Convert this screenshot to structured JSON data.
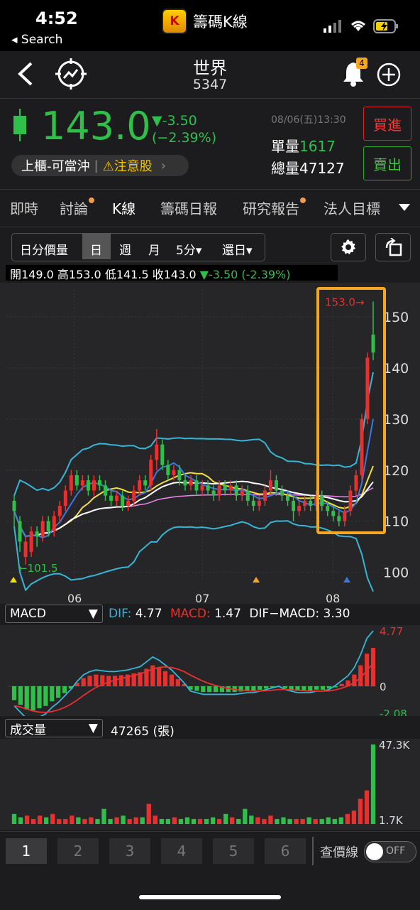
{
  "status": {
    "time": "4:52",
    "back_label": "◂ Search",
    "app_title": "籌碼K線",
    "logo_letter": "K",
    "battery_icon": "battery-charging-icon"
  },
  "header": {
    "name": "世界",
    "code": "5347",
    "notification_count": "4"
  },
  "quote": {
    "price": "143.0",
    "change": "▼-3.50",
    "change_pct": "(−2.39%)",
    "datetime": "08/06(五)13:30",
    "single_vol_label": "單量",
    "single_vol": "1617",
    "total_vol_label": "總量",
    "total_vol": "47127",
    "buy_label": "買進",
    "sell_label": "賣出",
    "badge_market": "上櫃-可當沖",
    "badge_warning": "⚠注意股"
  },
  "tabs": [
    "即時",
    "討論",
    "K線",
    "籌碼日報",
    "研究報告",
    "法人目標"
  ],
  "chart_toolbar": {
    "opt1": "日分價量",
    "opt2": "日",
    "opt3": "週",
    "opt4": "月",
    "opt5": "5分▾",
    "opt6": "還日▾"
  },
  "ohlc_bar": {
    "open": "開149.0",
    "high": "高153.0",
    "low": "低141.5",
    "close": "收143.0",
    "chg": "▼-3.50 (-2.39%)"
  },
  "price_chart": {
    "y_ticks": [
      "150",
      "140",
      "130",
      "120",
      "110",
      "100"
    ],
    "x_ticks": [
      "06",
      "07",
      "08"
    ],
    "high_label": "153.0→",
    "low_label": "←101.5"
  },
  "macd": {
    "selector": "MACD",
    "dif_label": "DIF:",
    "dif": "4.77",
    "macd_label": "MACD:",
    "macd": "1.47",
    "diff_label": "DIF−MACD:",
    "diff": "3.30",
    "y_ticks": [
      "4.77",
      "0",
      "-2.08"
    ]
  },
  "volume": {
    "selector": "成交量",
    "value": "47265 (張)",
    "y_ticks": [
      "47.3K",
      "1.7K"
    ]
  },
  "bottom": {
    "pages": [
      "1",
      "2",
      "3",
      "4",
      "5",
      "6"
    ],
    "line_label": "查價線",
    "toggle": "OFF"
  },
  "colors": {
    "up": "#e8312f",
    "down": "#2fbf4a",
    "bg": "#1c1c1e",
    "highlight": "#f5a623",
    "band": "#35b6d6",
    "ma1": "#ffffff",
    "ma2": "#f0e040",
    "ma3": "#ee88ee",
    "ma4": "#3a78e0"
  },
  "chart_data": {
    "type": "candlestick",
    "ylim": [
      98,
      155
    ],
    "ohlc": [
      [
        114,
        112,
        109,
        115,
        0
      ],
      [
        110,
        106,
        104,
        111,
        0
      ],
      [
        106,
        103,
        101.5,
        107,
        1
      ],
      [
        104,
        108,
        103,
        109,
        1
      ],
      [
        108,
        107,
        105,
        109,
        0
      ],
      [
        107,
        110,
        106,
        111,
        1
      ],
      [
        110,
        108,
        107,
        111,
        0
      ],
      [
        108,
        111,
        107,
        112,
        1
      ],
      [
        111,
        113,
        110,
        114,
        1
      ],
      [
        113,
        116,
        112,
        117,
        1
      ],
      [
        116,
        119,
        115,
        120,
        1
      ],
      [
        119,
        117,
        116,
        120,
        0
      ],
      [
        117,
        118,
        116,
        119,
        1
      ],
      [
        118,
        116,
        115,
        119,
        0
      ],
      [
        116,
        118,
        115,
        119,
        1
      ],
      [
        118,
        117,
        116,
        119,
        0
      ],
      [
        117,
        115,
        114,
        118,
        0
      ],
      [
        115,
        114,
        113,
        116,
        0
      ],
      [
        114,
        115,
        113,
        116,
        1
      ],
      [
        115,
        113,
        112,
        116,
        0
      ],
      [
        113,
        114,
        112,
        115,
        1
      ],
      [
        114,
        116,
        113,
        117,
        1
      ],
      [
        116,
        118,
        115,
        119,
        1
      ],
      [
        118,
        117,
        116,
        119,
        0
      ],
      [
        117,
        122,
        116,
        123,
        1
      ],
      [
        122,
        125,
        120,
        128,
        1
      ],
      [
        125,
        121,
        120,
        126,
        0
      ],
      [
        121,
        119,
        118,
        122,
        0
      ],
      [
        119,
        120,
        118,
        121,
        1
      ],
      [
        120,
        118,
        117,
        121,
        0
      ],
      [
        118,
        117,
        116,
        119,
        0
      ],
      [
        117,
        118,
        116,
        119,
        1
      ],
      [
        118,
        116,
        115,
        119,
        0
      ],
      [
        116,
        117,
        115,
        118,
        1
      ],
      [
        117,
        116,
        115,
        118,
        0
      ],
      [
        116,
        115,
        114,
        117,
        0
      ],
      [
        115,
        117,
        114,
        118,
        1
      ],
      [
        117,
        116,
        115,
        118,
        0
      ],
      [
        116,
        117,
        115,
        118,
        1
      ],
      [
        117,
        115,
        114,
        118,
        0
      ],
      [
        115,
        116,
        114,
        117,
        1
      ],
      [
        116,
        114,
        113,
        117,
        0
      ],
      [
        114,
        113,
        112,
        115,
        0
      ],
      [
        113,
        114,
        112,
        115,
        1
      ],
      [
        114,
        116,
        113,
        117,
        1
      ],
      [
        116,
        118,
        115,
        120,
        1
      ],
      [
        118,
        116,
        115,
        119,
        0
      ],
      [
        116,
        115,
        114,
        117,
        0
      ],
      [
        115,
        114,
        113,
        116,
        0
      ],
      [
        114,
        112,
        110,
        115,
        0
      ],
      [
        112,
        113,
        111,
        114,
        1
      ],
      [
        113,
        114,
        112,
        115,
        1
      ],
      [
        114,
        113,
        112,
        115,
        0
      ],
      [
        113,
        115,
        112,
        116,
        1
      ],
      [
        115,
        113,
        112,
        116,
        0
      ],
      [
        113,
        112,
        111,
        114,
        0
      ],
      [
        112,
        111,
        110,
        113,
        0
      ],
      [
        111,
        110,
        109,
        112,
        0
      ],
      [
        110,
        112,
        109,
        113,
        1
      ],
      [
        112,
        116,
        111,
        117,
        1
      ],
      [
        116,
        119,
        115,
        120,
        1
      ],
      [
        119,
        130,
        118,
        131,
        1
      ],
      [
        130,
        142,
        129,
        143,
        1
      ],
      [
        146.5,
        143,
        141.5,
        153,
        0
      ]
    ],
    "macd_hist": [
      -1.2,
      -1.6,
      -2.0,
      -2.08,
      -1.9,
      -1.7,
      -1.3,
      -1.0,
      -0.6,
      -0.2,
      0.3,
      0.7,
      0.9,
      1.0,
      0.95,
      0.9,
      0.9,
      0.95,
      1.0,
      1.1,
      1.2,
      1.5,
      1.8,
      1.6,
      1.3,
      1.0,
      0.6,
      0.2,
      -0.3,
      -0.4,
      -0.5,
      -0.5,
      -0.5,
      -0.5,
      -0.5,
      -0.5,
      -0.45,
      -0.4,
      -0.4,
      -0.3,
      -0.2,
      -0.1,
      0.0,
      -0.2,
      -0.3,
      -0.4,
      -0.4,
      -0.4,
      -0.3,
      -0.3,
      -0.2,
      -0.1,
      0.2,
      0.5,
      1.0,
      1.8,
      2.8,
      3.3
    ],
    "volume": [
      6,
      4,
      5,
      3,
      5,
      4,
      6,
      3,
      3,
      5,
      4,
      3,
      4,
      3,
      9,
      3,
      4,
      5,
      3,
      4,
      4,
      12,
      5,
      3,
      3,
      4,
      3,
      4,
      3,
      3,
      3,
      4,
      3,
      6,
      4,
      3,
      9,
      5,
      4,
      3,
      5,
      3,
      4,
      3,
      3,
      3,
      4,
      3,
      3,
      4,
      3,
      4,
      6,
      8,
      15,
      20,
      47.3
    ]
  }
}
